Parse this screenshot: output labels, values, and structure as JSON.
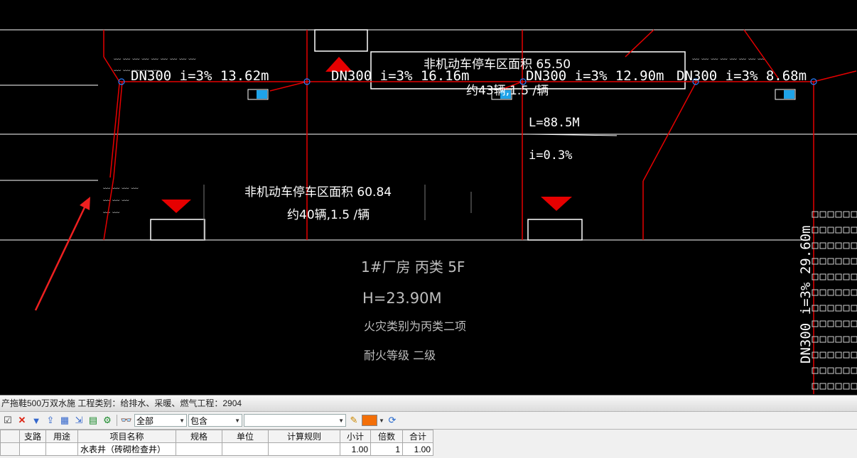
{
  "drawing": {
    "pipe_labels": [
      "DN300 i=3% 13.62m",
      "DN300 i=3% 16.16m",
      "DN300 i=3% 12.90m",
      "DN300 i=3% 8.68m",
      "DN300 i=3% 29.60m"
    ],
    "parking_area_1": {
      "title": "非机动车停车区面积 65.50",
      "count": "约43辆,1.5 /辆"
    },
    "parking_area_2": {
      "title": "非机动车停车区面积 60.84",
      "count": "约40辆,1.5 /辆"
    },
    "length_label": "L=88.5M",
    "slope_label": "i=0.3%",
    "building": {
      "name": "1#厂房 丙类 5F",
      "height": "H=23.90M",
      "fire_class": "火灾类别为丙类二项",
      "fire_rating": "耐火等级 二级"
    },
    "colors": {
      "pipe": "#e60000",
      "wall": "#ffffff",
      "marker": "#e60000",
      "box": "#1fa3e8",
      "arrow": "#ee2020"
    }
  },
  "panel": {
    "title": "产拖鞋500万双水施  工程类别：给排水、采暖、燃气工程：2904",
    "toolbar": {
      "scope_select": "全部",
      "match_select": "包含",
      "filter_select": "",
      "icons": [
        "check-icon",
        "delete-icon",
        "filter-icon",
        "export-icon",
        "table-icon",
        "import-icon",
        "excel-icon",
        "settings-icon",
        "binoculars-icon",
        "pencil-icon",
        "color-icon",
        "refresh-icon"
      ]
    },
    "table": {
      "headers": [
        "",
        "支路",
        "用途",
        "项目名称",
        "规格",
        "单位",
        "计算规则",
        "小计",
        "倍数",
        "合计"
      ],
      "rows": [
        {
          "check": "",
          "branch": "",
          "usage": "",
          "name": "水表井（砖砌检查井）",
          "spec": "",
          "unit": "",
          "rule": "",
          "subtotal": "1.00",
          "multiplier": "1",
          "total": "1.00"
        }
      ]
    }
  }
}
